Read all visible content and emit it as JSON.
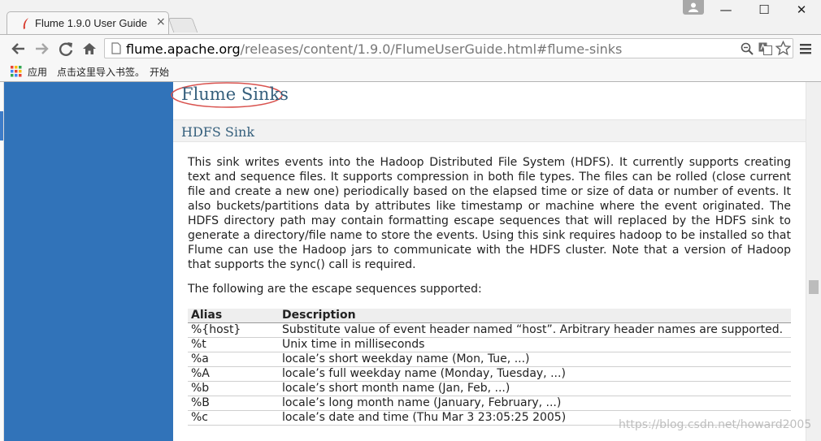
{
  "browser": {
    "tab_title": "Flume 1.9.0 User Guide",
    "tab_close": "×",
    "url_host": "flume.apache.org",
    "url_path": "/releases/content/1.9.0/FlumeUserGuide.html#flume-sinks",
    "window_minimize": "—",
    "window_maximize": "☐",
    "window_close": "✕",
    "bookmarks": [
      "应用",
      "点击这里导入书签。",
      "开始"
    ]
  },
  "colors": {
    "sidebar": "#3173b9",
    "heading": "#355f7c",
    "annotation_ellipse": "#d9534f"
  },
  "page": {
    "section_title": "Flume Sinks",
    "subsection_title": "HDFS Sink",
    "intro": "This sink writes events into the Hadoop Distributed File System (HDFS). It currently supports creating text and sequence files. It supports compression in both file types. The files can be rolled (close current file and create a new one) periodically based on the elapsed time or size of data or number of events. It also buckets/partitions data by attributes like timestamp or machine where the event originated. The HDFS directory path may contain formatting escape sequences that will replaced by the HDFS sink to generate a directory/file name to store the events. Using this sink requires hadoop to be installed so that Flume can use the Hadoop jars to communicate with the HDFS cluster. Note that a version of Hadoop that supports the sync() call is required.",
    "escape_intro": "The following are the escape sequences supported:",
    "table": {
      "headers": [
        "Alias",
        "Description"
      ],
      "rows": [
        {
          "alias": "%{host}",
          "description": "Substitute value of event header named “host”. Arbitrary header names are supported."
        },
        {
          "alias": "%t",
          "description": "Unix time in milliseconds"
        },
        {
          "alias": "%a",
          "description": "locale’s short weekday name (Mon, Tue, ...)"
        },
        {
          "alias": "%A",
          "description": "locale’s full weekday name (Monday, Tuesday, ...)"
        },
        {
          "alias": "%b",
          "description": "locale’s short month name (Jan, Feb, ...)"
        },
        {
          "alias": "%B",
          "description": "locale’s long month name (January, February, ...)"
        },
        {
          "alias": "%c",
          "description": "locale’s date and time (Thu Mar 3 23:05:25 2005)"
        }
      ]
    },
    "watermark": "https://blog.csdn.net/howard2005"
  }
}
